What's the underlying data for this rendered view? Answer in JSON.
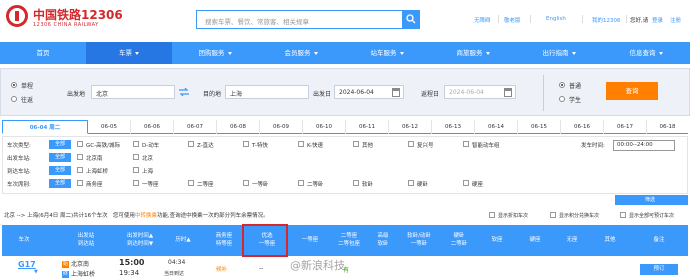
{
  "header": {
    "brand": "中国铁路12306",
    "brand_sub": "12306 CHINA RAILWAY",
    "search_placeholder": "搜索车票、餐饮、常旅客、相关规章",
    "links": [
      "无障碍",
      "敬老版",
      "English",
      "我的12306"
    ],
    "greeting": "您好,请",
    "login": "登录",
    "register": "注册"
  },
  "nav": {
    "items": [
      "首页",
      "车票",
      "团购服务",
      "会员服务",
      "站车服务",
      "商旅服务",
      "出行指南",
      "信息查询"
    ],
    "active_index": 1
  },
  "query": {
    "trip_types": [
      "单程",
      "往返"
    ],
    "trip_selected": "单程",
    "from_label": "出发地",
    "from_value": "北京",
    "to_label": "目的地",
    "to_value": "上海",
    "depart_label": "出发日",
    "depart_value": "2024-06-04",
    "return_label": "返程日",
    "return_value": "2024-06-04",
    "ticket_types": [
      "普通",
      "学生"
    ],
    "ticket_selected": "普通",
    "search_button": "查询"
  },
  "date_tabs": [
    "06-04 周二",
    "06-05",
    "06-06",
    "06-07",
    "06-08",
    "06-09",
    "06-10",
    "06-11",
    "06-12",
    "06-13",
    "06-14",
    "06-15",
    "06-16",
    "06-17",
    "06-18"
  ],
  "filters": {
    "all_label": "全部",
    "train_type_label": "车次类型:",
    "train_types": [
      "GC-高铁/城际",
      "D-动车",
      "Z-直达",
      "T-特快",
      "K-快速",
      "其他",
      "复兴号",
      "智能动车组"
    ],
    "depart_time_label": "发车时间:",
    "depart_time_value": "00:00--24:00",
    "from_station_label": "出发车站:",
    "from_stations": [
      "北京南",
      "北京"
    ],
    "to_station_label": "到达车站:",
    "to_stations": [
      "上海虹桥",
      "上海"
    ],
    "seat_label": "车次席别:",
    "seats": [
      "商务座",
      "一等座",
      "二等座",
      "一等卧",
      "二等卧",
      "软卧",
      "硬卧",
      "硬座"
    ],
    "filter_button": "筛选"
  },
  "summary": {
    "route": "北京 --> 上海(6月4日 周二)共计16个车次",
    "note_prefix": "您可使用",
    "note_highlight": "中转换乘",
    "note_suffix": "功能,查询途中换乘一次的部分列车余票情况。",
    "checks": [
      "显示折扣车次",
      "显示积分兑换车次",
      "显示全部可预订车次"
    ]
  },
  "table": {
    "headers": [
      "车次",
      "出发站\n到达站",
      "出发时间▲\n到达时间▼",
      "历时▲",
      "商务座\n特等座",
      "优选\n一等座",
      "一等座",
      "二等座\n二等包座",
      "高级\n软卧",
      "软卧/动卧\n一等卧",
      "硬卧\n二等卧",
      "软座",
      "硬座",
      "无座",
      "其他",
      "备注"
    ],
    "row": {
      "train": "G17",
      "from_badge": "始",
      "from": "北京南",
      "to_badge": "终",
      "to": "上海虹桥",
      "depart": "15:00",
      "arrive": "19:34",
      "duration": "04:34",
      "duration_note": "当日到达",
      "business": "候补",
      "cols": [
        "--",
        "--",
        "有",
        "--",
        "--",
        "--",
        "--",
        "--",
        "--",
        "--"
      ],
      "book": "预订"
    }
  },
  "watermark": "@新浪科技"
}
